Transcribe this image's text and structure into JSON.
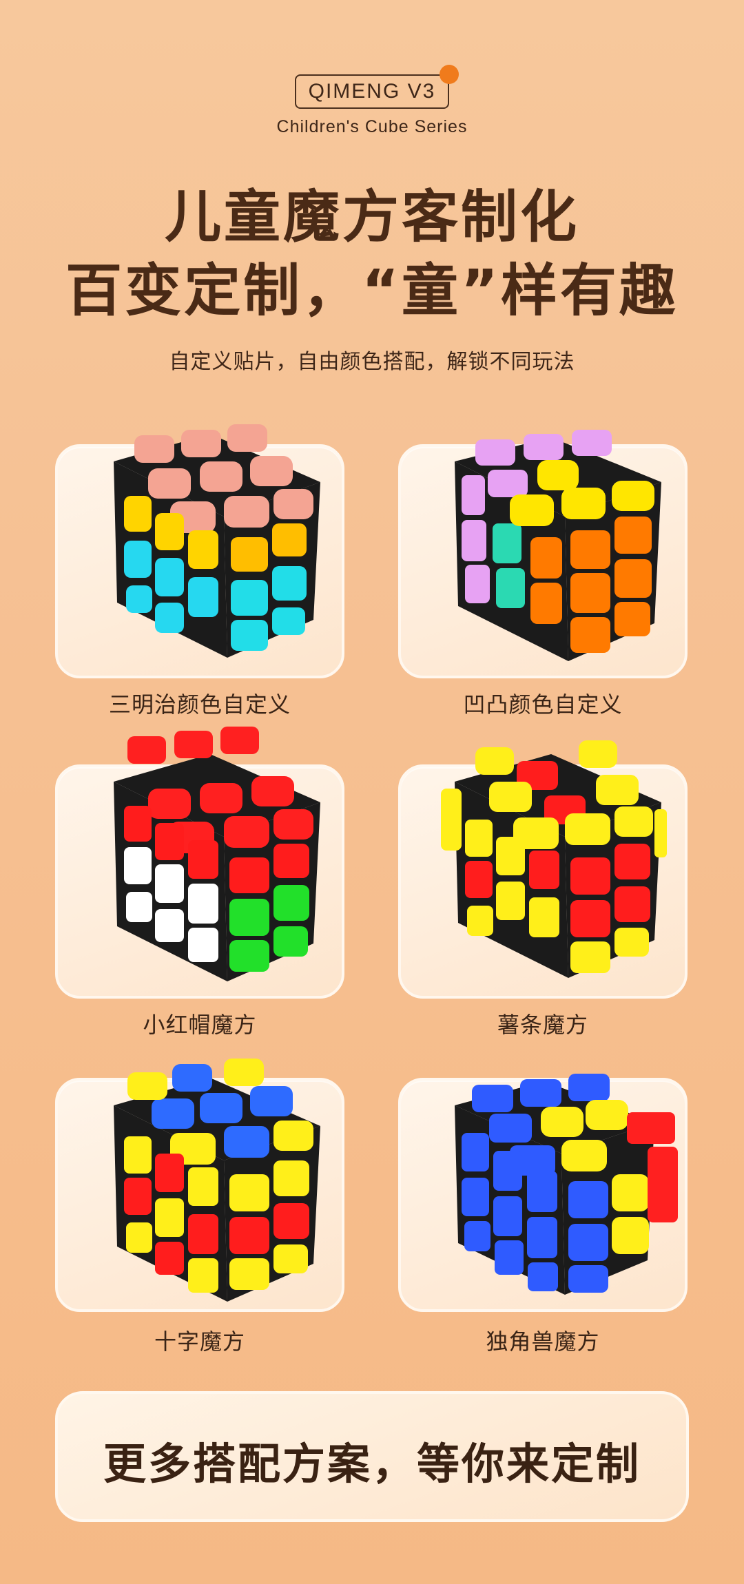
{
  "header": {
    "badge": "QIMENG V3",
    "series": "Children's Cube Series",
    "headline_line1": "儿童魔方客制化",
    "headline_line2": "百变定制，“童”样有趣",
    "subtitle": "自定义贴片，自由颜色搭配，解锁不同玩法"
  },
  "cards": [
    {
      "caption": "三明治颜色自定义",
      "colors": {
        "top": "#f4a493",
        "left": "#ffd400",
        "right": "#ffbe00",
        "leftBottom": "#26d8f0",
        "rightBottom": "#22dde8"
      }
    },
    {
      "caption": "凹凸颜色自定义",
      "colors": {
        "top": "#e7a2f3",
        "left": "#e7a2f3",
        "right": "#ff7a00",
        "accent": "#ffe600",
        "leftBottom": "#2bd9b2"
      }
    },
    {
      "caption": "小红帽魔方",
      "colors": {
        "top": "#ff2020",
        "left": "#ffffff",
        "right": "#ff1c1c",
        "rightBottom": "#22e02a"
      }
    },
    {
      "caption": "薯条魔方",
      "colors": {
        "top": "#ff1d1d",
        "accent": "#ffef1a",
        "left": "#ffef1a",
        "right": "#ff1d1d"
      }
    },
    {
      "caption": "十字魔方",
      "colors": {
        "top": "#2e6bff",
        "accent": "#ffef1a",
        "left": "#ffef1a",
        "right": "#ff1d1d"
      }
    },
    {
      "caption": "独角兽魔方",
      "colors": {
        "top": "#2f5bff",
        "left": "#2f5bff",
        "right": "#2f5bff",
        "accent": "#ffef1a",
        "tab": "#ff2020"
      }
    }
  ],
  "footer": {
    "text": "更多搭配方案，等你来定制"
  }
}
